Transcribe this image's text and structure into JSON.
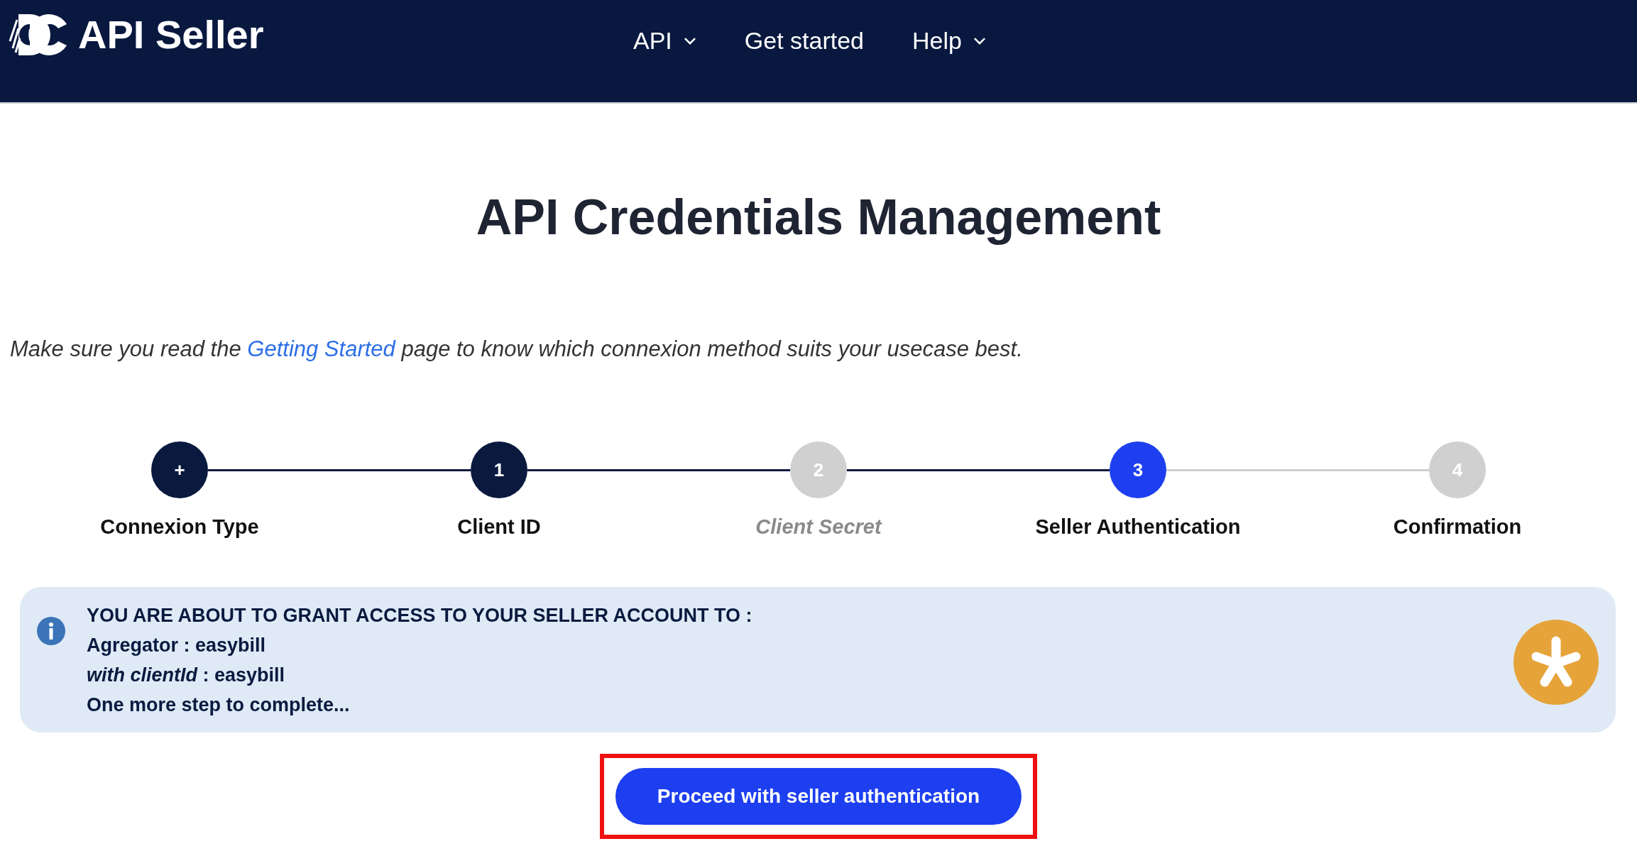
{
  "header": {
    "brand": "API Seller",
    "nav": [
      {
        "label": "API",
        "dropdown": true
      },
      {
        "label": "Get started",
        "dropdown": false
      },
      {
        "label": "Help",
        "dropdown": true
      }
    ]
  },
  "title": "API Credentials Management",
  "intro": {
    "before": "Make sure you read the ",
    "link": "Getting Started",
    "after": " page to know which connexion method suits your usecase best."
  },
  "steps": [
    {
      "marker": "+",
      "label": "Connexion Type",
      "kind": "done"
    },
    {
      "marker": "1",
      "label": "Client ID",
      "kind": "done"
    },
    {
      "marker": "2",
      "label": "Client Secret",
      "kind": "skipped"
    },
    {
      "marker": "3",
      "label": "Seller Authentication",
      "kind": "current"
    },
    {
      "marker": "4",
      "label": "Confirmation",
      "kind": "pending"
    }
  ],
  "notice": {
    "heading": "YOU ARE ABOUT TO GRANT ACCESS TO YOUR SELLER ACCOUNT TO :",
    "lines": [
      "Agregator : easybill",
      "*with clientId* : easybill",
      "One more step to complete..."
    ]
  },
  "button": {
    "label": "Proceed with seller authentication",
    "highlighted": true
  }
}
